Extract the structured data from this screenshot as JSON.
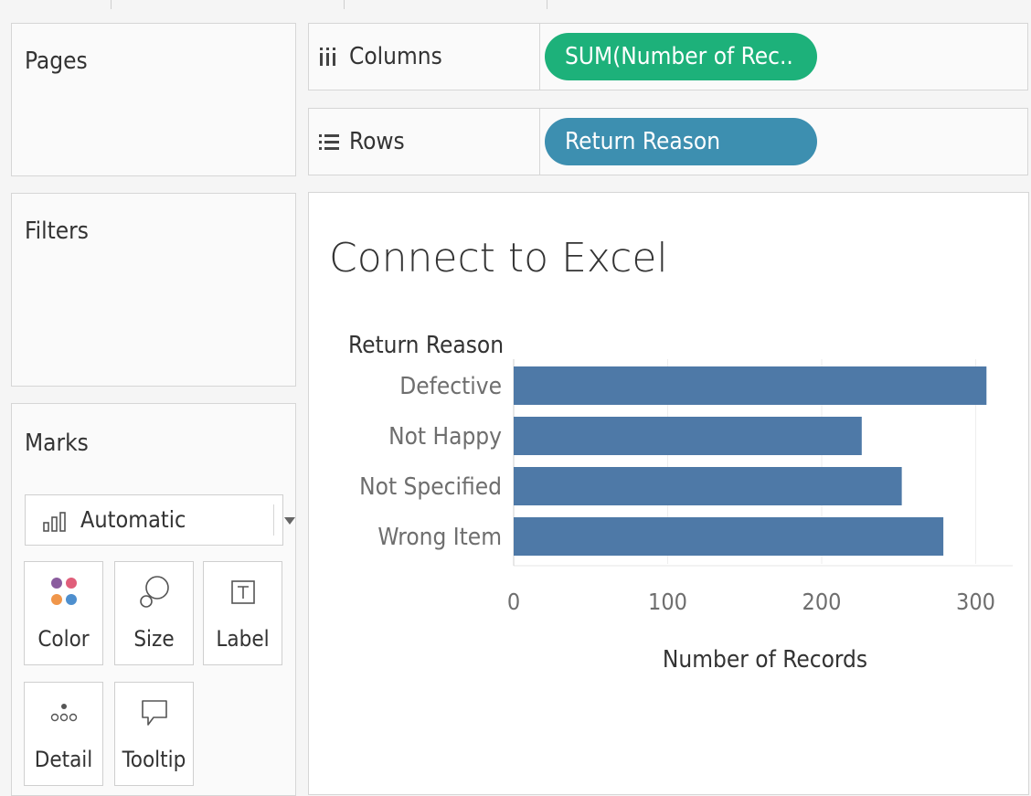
{
  "shelves": {
    "pages": "Pages",
    "filters": "Filters",
    "marks": "Marks",
    "columns_label": "Columns",
    "columns_pill": "SUM(Number of Rec..",
    "rows_label": "Rows",
    "rows_pill": "Return Reason"
  },
  "marks_card": {
    "type_selected": "Automatic",
    "buttons": {
      "color": "Color",
      "size": "Size",
      "label": "Label",
      "detail": "Detail",
      "tooltip": "Tooltip"
    }
  },
  "colors": {
    "columns_pill": "#1db17a",
    "rows_pill": "#3d8fb0",
    "bar": "#4e79a7"
  },
  "sheet": {
    "title": "Connect to Excel"
  },
  "chart_data": {
    "type": "bar",
    "orientation": "horizontal",
    "row_header": "Return Reason",
    "categories": [
      "Defective",
      "Not Happy",
      "Not Specified",
      "Wrong Item"
    ],
    "values": [
      307,
      226,
      252,
      279
    ],
    "xlabel": "Number of Records",
    "xlim": [
      0,
      320
    ],
    "xticks": [
      0,
      100,
      200,
      300
    ],
    "grid": "vertical",
    "bar_color": "#4e79a7"
  }
}
